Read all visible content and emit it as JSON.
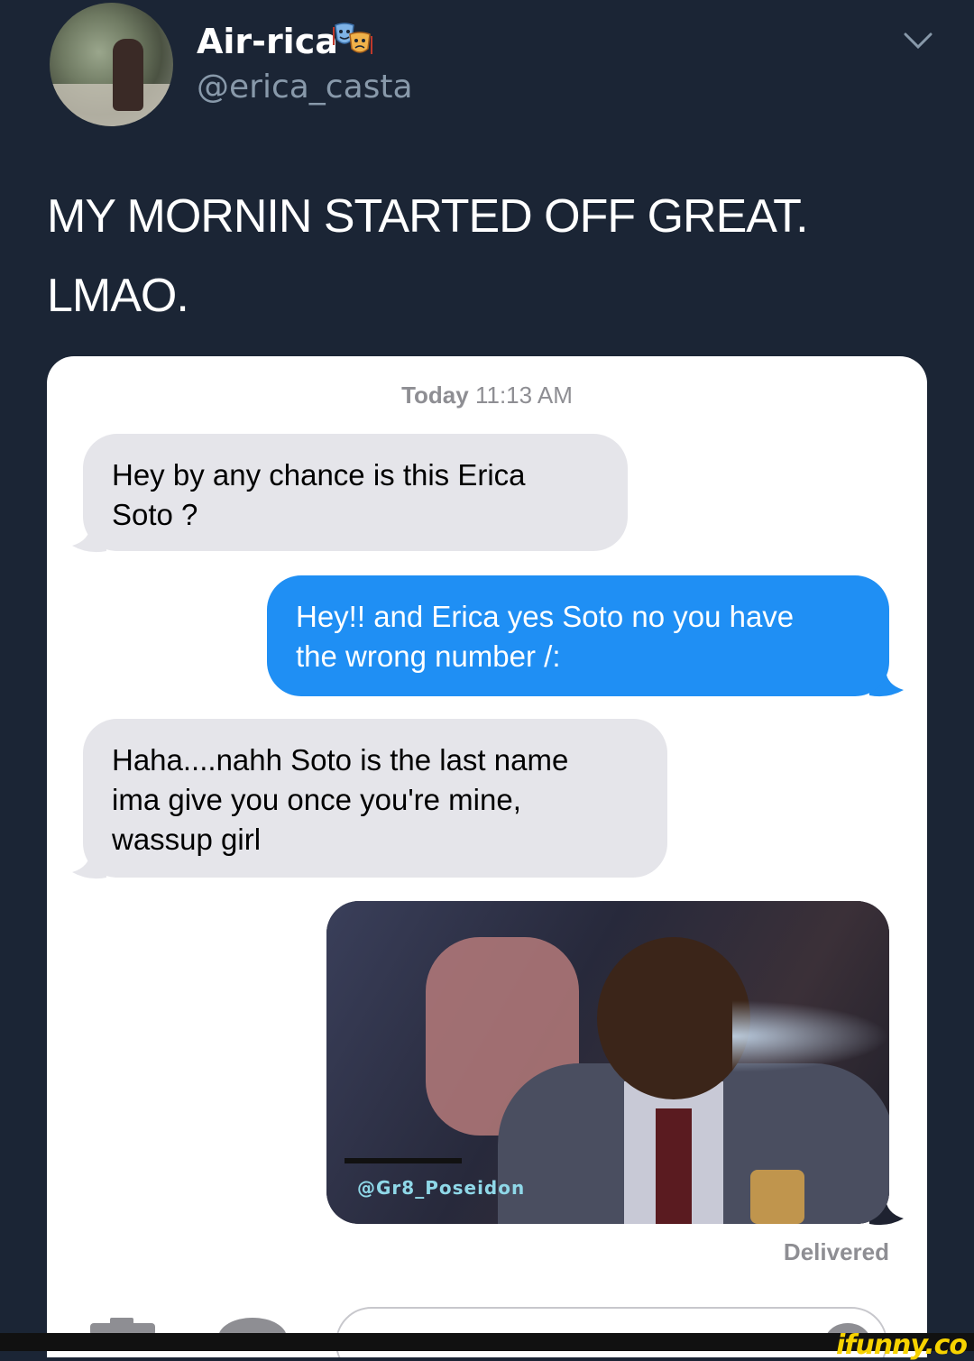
{
  "tweet": {
    "display_name": "Air-rica",
    "handle": "@erica_casta",
    "text_line1": "MY MORNIN STARTED OFF GREAT.",
    "text_line2": "LMAO.",
    "name_emoji_icon": "performing-arts-masks-icon",
    "menu_icon": "chevron-down-icon"
  },
  "imessage": {
    "timestamp_day": "Today",
    "timestamp_time": "11:13 AM",
    "messages": [
      {
        "direction": "incoming",
        "line1": "Hey by any chance  is this Erica",
        "line2": "Soto ?",
        "line3": ""
      },
      {
        "direction": "outgoing",
        "line1": "Hey!! and Erica yes Soto no you have",
        "line2": "the wrong number /:",
        "line3": ""
      },
      {
        "direction": "incoming",
        "line1": "Haha....nahh Soto is the last name",
        "line2": "ima give you once you're mine,",
        "line3": "wassup girl"
      }
    ],
    "gif_watermark": "@Gr8_Poseidon",
    "status": "Delivered"
  },
  "watermark": {
    "site": "ifunny.co"
  },
  "colors": {
    "background": "#1b2535",
    "incoming_bubble": "#e5e5ea",
    "outgoing_bubble": "#1f8ff4",
    "ifunny_yellow": "#f7d300"
  }
}
